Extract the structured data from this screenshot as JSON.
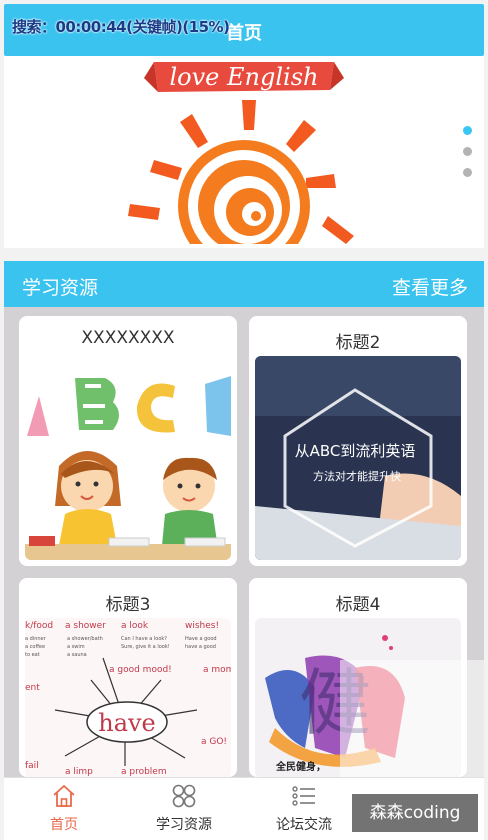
{
  "overlay_text": "搜索：00:00:44(关键帧)(15%)",
  "header": {
    "title": "首页"
  },
  "carousel": {
    "logo_text": "love English",
    "slide_count": 3,
    "active_index": 0
  },
  "section": {
    "title": "学习资源",
    "more_label": "查看更多"
  },
  "cards": [
    {
      "title": "XXXXXXXX",
      "image": "abc-kids"
    },
    {
      "title": "标题2",
      "image": "abc-fluent-english",
      "img_line1": "从ABC到流利英语",
      "img_line2": "方法对才能提升快"
    },
    {
      "title": "标题3",
      "image": "have-mindmap",
      "img_word": "have",
      "img_snippets": [
        "a shower",
        "a look",
        "wishes!",
        "a good mood!",
        "a mom",
        "a GO!",
        "a problem",
        "a limp",
        "fail"
      ]
    },
    {
      "title": "标题4",
      "image": "fitness-calligraphy",
      "img_char": "健",
      "img_caption": "全民健身，"
    }
  ],
  "nav": [
    {
      "label": "首页",
      "icon": "home-icon",
      "active": true
    },
    {
      "label": "学习资源",
      "icon": "grid-icon",
      "active": false
    },
    {
      "label": "论坛交流",
      "icon": "list-icon",
      "active": false
    }
  ],
  "watermark": "森森coding",
  "colors": {
    "primary": "#3ac3ef",
    "active": "#e86a4a",
    "grid_bg": "#d3d1d3"
  }
}
